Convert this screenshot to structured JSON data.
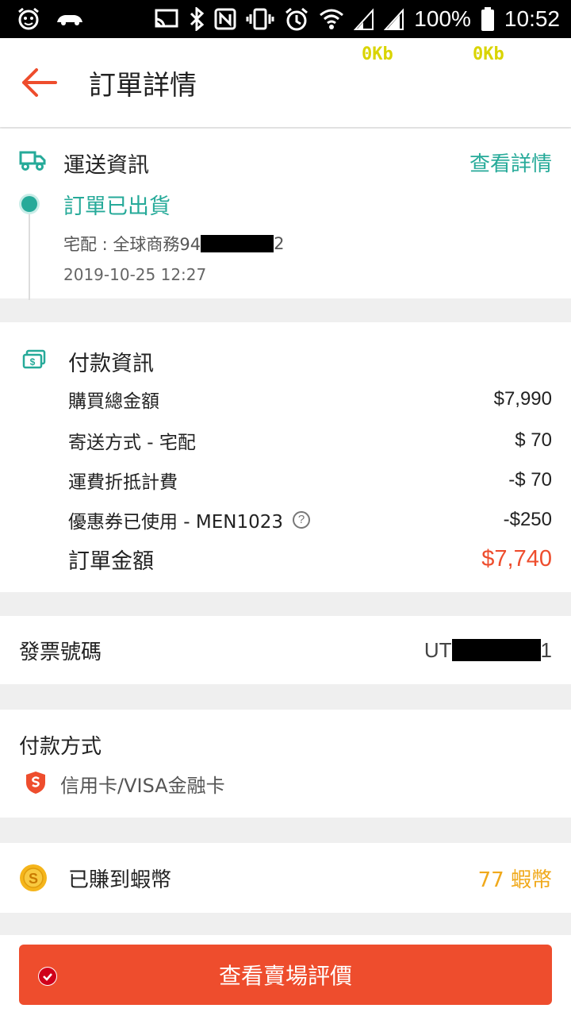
{
  "status_bar": {
    "battery": "100%",
    "time": "10:52"
  },
  "net_speed": {
    "left": "0Kb",
    "right": "0Kb"
  },
  "header": {
    "title": "訂單詳情"
  },
  "shipping": {
    "title": "運送資訊",
    "detail_link": "查看詳情",
    "status": "訂單已出貨",
    "courier_prefix": "宅配 :  全球商務94",
    "courier_suffix": "2",
    "date": "2019-10-25 12:27"
  },
  "payment_info": {
    "title": "付款資訊",
    "rows": [
      {
        "label": "購買總金額",
        "value": "$7,990"
      },
      {
        "label": "寄送方式 - 宅配",
        "value": "$ 70"
      },
      {
        "label": "運費折抵計費",
        "value": "-$ 70"
      },
      {
        "label": "優惠券已使用 - MEN1023",
        "value": "-$250"
      }
    ],
    "total_label": "訂單金額",
    "total_value": "$7,740"
  },
  "invoice": {
    "label": "發票號碼",
    "prefix": "UT",
    "suffix": "1"
  },
  "payment_method": {
    "label": "付款方式",
    "method": "信用卡/VISA金融卡"
  },
  "coins": {
    "label": "已賺到蝦幣",
    "value": "77 蝦幣"
  },
  "cta": {
    "label": "查看賣場評價"
  },
  "colors": {
    "accent": "#ee4d2d",
    "teal": "#26aa99",
    "coin": "#f0a91b"
  }
}
